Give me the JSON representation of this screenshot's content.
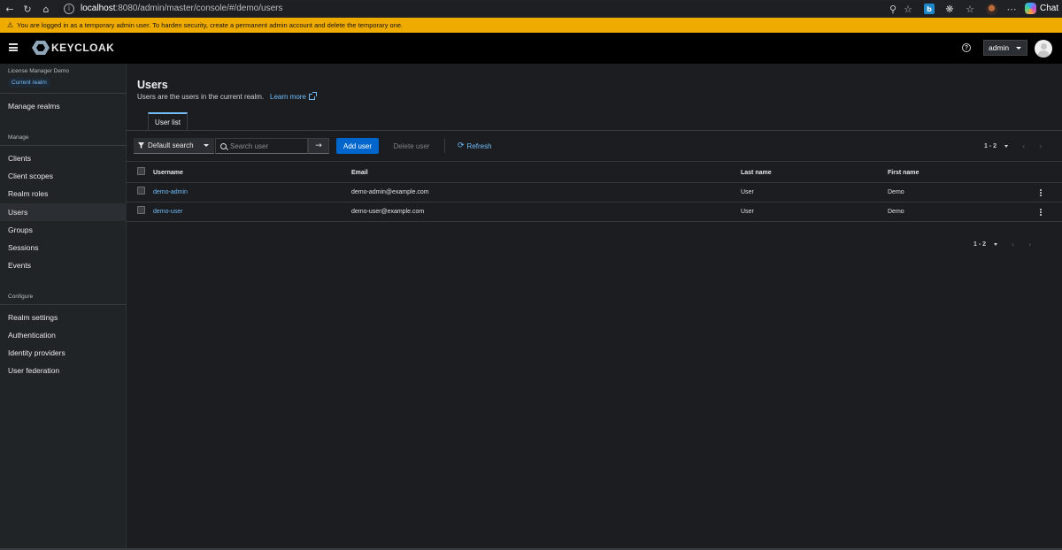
{
  "browser": {
    "url_host": "localhost",
    "url_rest": ":8080/admin/master/console/#/demo/users",
    "chat_label": "Chat"
  },
  "warning_banner": "You are logged in as a temporary admin user. To harden security, create a permanent admin account and delete the temporary one.",
  "masthead": {
    "logo_text": "KEYCLOAK",
    "help_glyph": "?",
    "user_menu_label": "admin"
  },
  "sidebar": {
    "realm_name": "License Manager Demo",
    "realm_badge": "Current realm",
    "manage_realms": "Manage realms",
    "manage_heading": "Manage",
    "manage_items": [
      "Clients",
      "Client scopes",
      "Realm roles",
      "Users",
      "Groups",
      "Sessions",
      "Events"
    ],
    "active_item": "Users",
    "configure_heading": "Configure",
    "configure_items": [
      "Realm settings",
      "Authentication",
      "Identity providers",
      "User federation"
    ]
  },
  "page": {
    "title": "Users",
    "description": "Users are the users in the current realm.",
    "learn_more": "Learn more",
    "tab": "User list"
  },
  "toolbar": {
    "filter_label": "Default search",
    "search_placeholder": "Search user",
    "add_user": "Add user",
    "delete_user": "Delete user",
    "refresh": "Refresh",
    "pagination_range": "1 - 2"
  },
  "table": {
    "columns": [
      "Username",
      "Email",
      "Last name",
      "First name"
    ],
    "rows": [
      {
        "username": "demo-admin",
        "email": "demo-admin@example.com",
        "last_name": "User",
        "first_name": "Demo"
      },
      {
        "username": "demo-user",
        "email": "demo-user@example.com",
        "last_name": "User",
        "first_name": "Demo"
      }
    ]
  },
  "colors": {
    "accent": "#0066cc",
    "link": "#73bcf7",
    "warning": "#f0ab00",
    "background": "#1b1d21",
    "sidebar": "#212427"
  }
}
